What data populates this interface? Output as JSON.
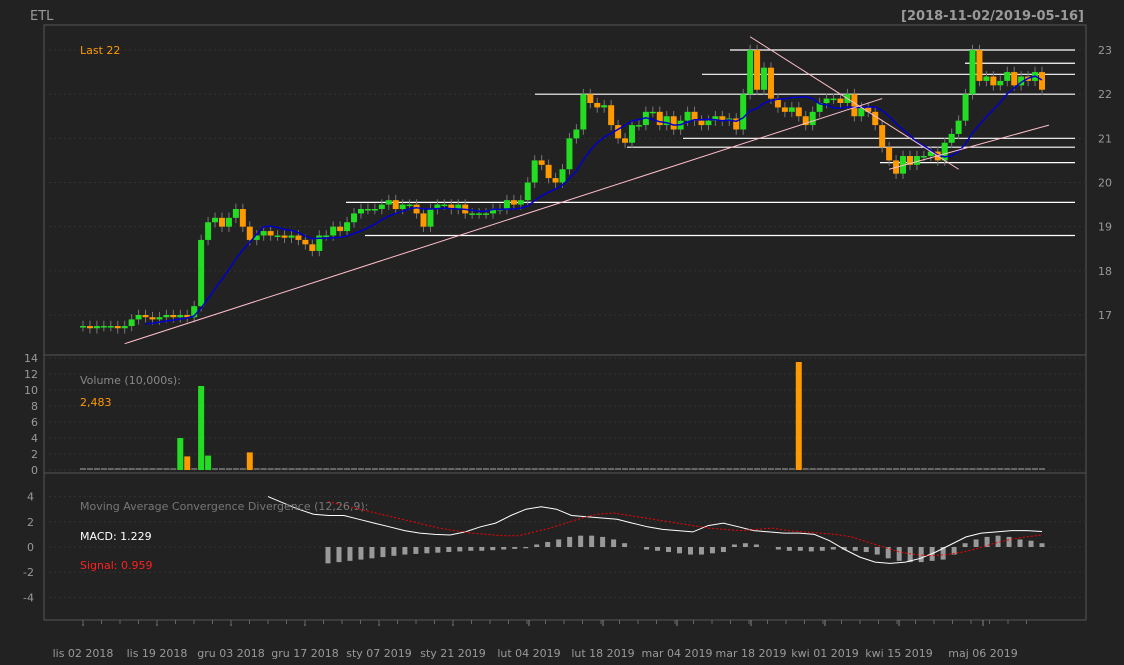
{
  "header": {
    "symbol": "ETL",
    "date_range": "[2018-11-02/2019-05-16]"
  },
  "colors": {
    "background": "#222222",
    "up": "#22dd22",
    "down": "#ff9900",
    "ma_line": "#0000cc",
    "trend_line": "#ffc0cb",
    "level_line": "#ffffff",
    "macd_line": "#ffffff",
    "signal_line": "#ff0000",
    "histogram": "#999999"
  },
  "chart_data": [
    {
      "type": "candlestick",
      "title": "ETL",
      "subtitle": "Last 22",
      "ylim": [
        16.2,
        23.2
      ],
      "y_ticks": [
        "17",
        "18",
        "19",
        "20",
        "21",
        "22",
        "23"
      ],
      "x_tick_labels": [
        "lis 02 2018",
        "lis 19 2018",
        "gru 03 2018",
        "gru 17 2018",
        "sty 07 2019",
        "sty 21 2019",
        "lut 04 2019",
        "lut 18 2019",
        "mar 04 2019",
        "mar 18 2019",
        "kwi 01 2019",
        "kwi 15 2019",
        "maj 06 2019"
      ],
      "closes": [
        16.75,
        16.7,
        16.75,
        16.75,
        16.75,
        16.7,
        16.75,
        16.9,
        17.0,
        16.95,
        16.9,
        16.95,
        17.0,
        16.95,
        17.0,
        16.95,
        17.2,
        18.7,
        19.1,
        19.2,
        19.0,
        19.2,
        19.4,
        19.0,
        18.7,
        18.8,
        18.9,
        18.8,
        18.8,
        18.75,
        18.8,
        18.7,
        18.6,
        18.45,
        18.8,
        18.8,
        19.0,
        18.9,
        19.1,
        19.3,
        19.4,
        19.4,
        19.4,
        19.5,
        19.6,
        19.4,
        19.5,
        19.5,
        19.3,
        19.0,
        19.4,
        19.5,
        19.5,
        19.4,
        19.5,
        19.3,
        19.3,
        19.3,
        19.3,
        19.4,
        19.4,
        19.6,
        19.5,
        19.6,
        20.0,
        20.5,
        20.4,
        20.1,
        20.0,
        20.3,
        21.0,
        21.2,
        22.0,
        21.8,
        21.7,
        21.75,
        21.3,
        21.0,
        20.9,
        21.3,
        21.3,
        21.6,
        21.6,
        21.3,
        21.5,
        21.2,
        21.4,
        21.6,
        21.4,
        21.3,
        21.4,
        21.5,
        21.4,
        21.45,
        21.2,
        22.0,
        23.0,
        22.1,
        22.6,
        21.9,
        21.7,
        21.6,
        21.7,
        21.5,
        21.3,
        21.6,
        21.8,
        21.9,
        21.9,
        21.8,
        22.0,
        21.5,
        21.7,
        21.6,
        21.3,
        20.8,
        20.5,
        20.2,
        20.6,
        20.4,
        20.6,
        20.6,
        20.7,
        20.5,
        20.9,
        21.1,
        21.4,
        22.0,
        23.0,
        22.3,
        22.4,
        22.2,
        22.3,
        22.5,
        22.2,
        22.4,
        22.3,
        22.5,
        22.1
      ],
      "ma_label": "",
      "horizontal_levels": [
        23.0,
        22.7,
        22.45,
        22.0,
        21.0,
        20.8,
        20.45,
        19.55,
        18.8
      ],
      "volume_panel": {
        "label": "Volume (10,000s):",
        "last_value": "2,483",
        "ylim": [
          0,
          14
        ],
        "y_ticks": [
          "0",
          "2",
          "4",
          "6",
          "8",
          "10",
          "12",
          "14"
        ],
        "spikes": [
          {
            "date": "2018-11-14",
            "value": 4.0
          },
          {
            "date": "2018-11-15",
            "value": 1.7
          },
          {
            "date": "2018-11-21",
            "value": 10.5
          },
          {
            "date": "2018-11-22",
            "value": 1.8
          },
          {
            "date": "2018-11-29",
            "value": 2.2
          },
          {
            "date": "2019-03-13",
            "value": 13.5
          }
        ]
      },
      "macd_panel": {
        "label": "Moving Average Convergence Divergence (12,26,9):",
        "macd_label": "MACD: 1.229",
        "signal_label": "Signal: 0.959",
        "ylim": [
          -6,
          6
        ],
        "y_ticks": [
          "4",
          "2",
          "0",
          "-2",
          "-4"
        ],
        "macd": [
          4.0,
          3.5,
          3.0,
          2.6,
          2.5,
          2.5,
          2.2,
          1.9,
          1.6,
          1.3,
          1.1,
          1.0,
          0.95,
          1.2,
          1.6,
          1.9,
          2.5,
          3.0,
          3.2,
          3.0,
          2.5,
          2.4,
          2.3,
          2.2,
          1.9,
          1.6,
          1.4,
          1.3,
          1.2,
          1.7,
          1.9,
          1.6,
          1.3,
          1.2,
          1.1,
          1.1,
          1.0,
          0.5,
          -0.2,
          -0.8,
          -1.2,
          -1.3,
          -1.2,
          -0.9,
          -0.4,
          0.2,
          0.8,
          1.1,
          1.2,
          1.3,
          1.3,
          1.229
        ],
        "signal": [
          3.6,
          3.3,
          3.0,
          2.7,
          2.4,
          2.1,
          1.8,
          1.5,
          1.3,
          1.1,
          1.0,
          0.9,
          0.9,
          1.2,
          1.5,
          1.9,
          2.3,
          2.6,
          2.7,
          2.5,
          2.3,
          2.1,
          1.9,
          1.7,
          1.5,
          1.4,
          1.3,
          1.4,
          1.5,
          1.3,
          1.2,
          1.1,
          1.0,
          0.8,
          0.4,
          0.0,
          -0.4,
          -0.6,
          -0.7,
          -0.6,
          -0.4,
          -0.1,
          0.3,
          0.6,
          0.8,
          0.959
        ],
        "histogram": [
          -1.3,
          -1.2,
          -1.1,
          -1.0,
          -0.9,
          -0.8,
          -0.7,
          -0.6,
          -0.55,
          -0.5,
          -0.45,
          -0.4,
          -0.35,
          -0.3,
          -0.3,
          -0.25,
          -0.2,
          -0.15,
          -0.1,
          0.2,
          0.4,
          0.6,
          0.8,
          0.9,
          0.9,
          0.8,
          0.6,
          0.3,
          0.0,
          -0.2,
          -0.3,
          -0.4,
          -0.5,
          -0.6,
          -0.6,
          -0.5,
          -0.4,
          0.2,
          0.3,
          0.2,
          0.0,
          -0.2,
          -0.3,
          -0.3,
          -0.35,
          -0.3,
          -0.2,
          -0.2,
          -0.3,
          -0.4,
          -0.6,
          -0.9,
          -1.1,
          -1.2,
          -1.2,
          -1.1,
          -1.0,
          -0.6,
          0.3,
          0.6,
          0.8,
          0.9,
          0.8,
          0.6,
          0.5,
          0.3
        ]
      }
    }
  ]
}
